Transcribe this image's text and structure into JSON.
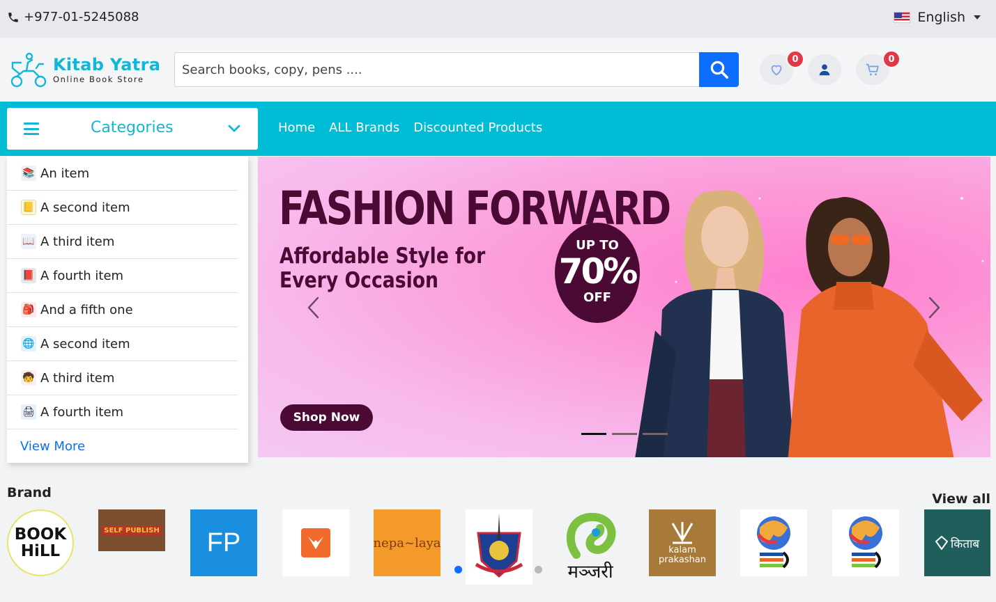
{
  "topbar": {
    "phone": "+977-01-5245088",
    "language": "English",
    "phone_icon": "phone-icon",
    "flag_icon": "us-flag-icon"
  },
  "header": {
    "logo_name": "Kitab Yatra",
    "logo_tagline": "Online Book Store",
    "search_placeholder": "Search books, copy, pens ....",
    "wishlist_count": "0",
    "cart_count": "0"
  },
  "nav": {
    "categories_label": "Categories",
    "links": [
      "Home",
      "ALL Brands",
      "Discounted Products"
    ]
  },
  "categories": {
    "items": [
      {
        "label": "An item",
        "icon": "books-stack-icon"
      },
      {
        "label": "A second item",
        "icon": "notebook-icon"
      },
      {
        "label": "A third item",
        "icon": "reader-icon"
      },
      {
        "label": "A fourth item",
        "icon": "book-icon"
      },
      {
        "label": "And a fifth one",
        "icon": "school-bag-icon"
      },
      {
        "label": "A second item",
        "icon": "globe-icon"
      },
      {
        "label": "A third item",
        "icon": "kids-icon"
      },
      {
        "label": "A fourth item",
        "icon": "printer-icon"
      }
    ],
    "view_more": "View More"
  },
  "banner": {
    "title": "FASHION FORWARD",
    "subtitle": "Affordable Style for Every Occasion",
    "promo_top": "UP TO",
    "promo_value": "70%",
    "promo_bottom": "OFF",
    "cta": "Shop Now",
    "active_slide": 1,
    "slide_count": 3,
    "colors": {
      "brand_dark": "#4a0a33",
      "accent_pink": "#fc9ad8"
    }
  },
  "brands": {
    "title": "Brand",
    "view_all": "View all",
    "tiles": [
      {
        "name": "book-hill-logo",
        "text": "BOOK HiLL"
      },
      {
        "name": "self-publish-logo",
        "text": "SELF PUBLISH"
      },
      {
        "name": "fp-logo",
        "text": "FP"
      },
      {
        "name": "orange-bird-logo",
        "text": ""
      },
      {
        "name": "nepalaya-logo",
        "text": "nepa~laya"
      },
      {
        "name": "emblem-logo",
        "text": ""
      },
      {
        "name": "manjari-logo",
        "text": "मञ्जरी"
      },
      {
        "name": "kalam-logo",
        "text": "kalam prakashan"
      },
      {
        "name": "globe-book-logo-1",
        "text": ""
      },
      {
        "name": "globe-book-logo-2",
        "text": ""
      },
      {
        "name": "kitab-publishers-logo",
        "text": "किताब"
      }
    ]
  },
  "colors": {
    "primary": "#0d6efd",
    "nav": "#00bcd4",
    "logo": "#12b6d6",
    "badge": "#e23744"
  }
}
